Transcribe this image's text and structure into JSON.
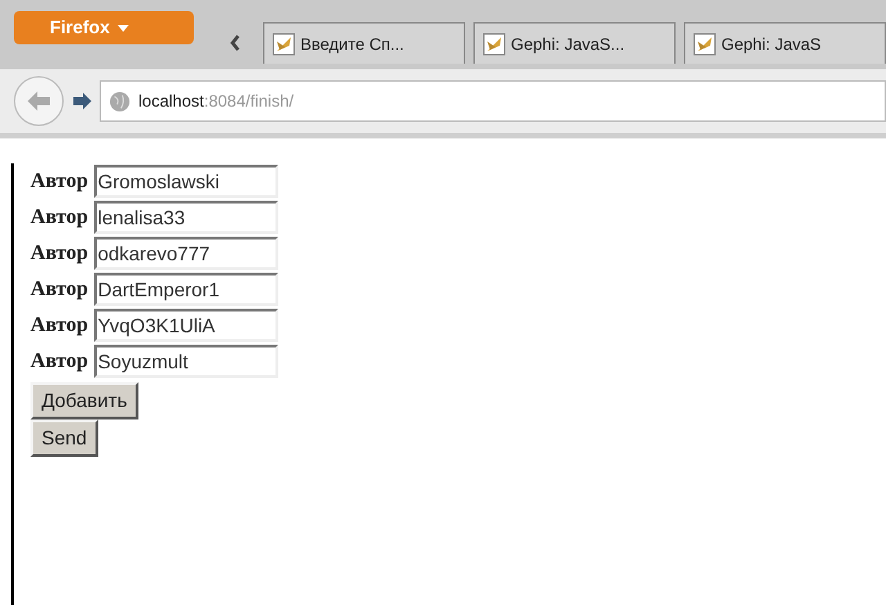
{
  "browser": {
    "menu_button": "Firefox",
    "tabs": [
      {
        "title": "Введите Сп..."
      },
      {
        "title": "Gephi: JavaS..."
      },
      {
        "title": "Gephi: JavaS"
      }
    ],
    "address": {
      "host": "localhost",
      "path": ":8084/finish/"
    }
  },
  "form": {
    "rows": [
      {
        "label": "Автор",
        "value": "Gromoslawski"
      },
      {
        "label": "Автор",
        "value": "lenalisa33"
      },
      {
        "label": "Автор",
        "value": "odkarevo777"
      },
      {
        "label": "Автор",
        "value": "DartEmperor1"
      },
      {
        "label": "Автор",
        "value": "YvqO3K1UliA"
      },
      {
        "label": "Автор",
        "value": "Soyuzmult"
      }
    ],
    "buttons": [
      "Добавить",
      "Send"
    ]
  }
}
